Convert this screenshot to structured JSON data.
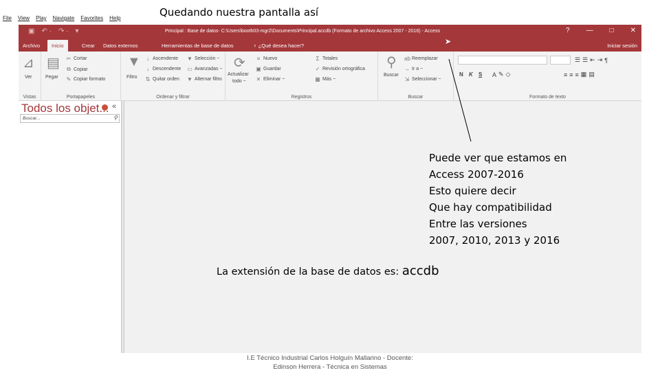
{
  "viewer_menu": [
    "File",
    "View",
    "Play",
    "Navigate",
    "Favorites",
    "Help"
  ],
  "slide_title": "Quedando nuestra pantalla así",
  "titlebar": {
    "title": "Principal : Base de datos- C:\\Users\\booth03-mgr2\\Documents\\Principal.accdb (Formato de archivo Access 2007 - 2016) - Access",
    "help": "?",
    "minimize": "—",
    "maximize": "□",
    "close": "✕",
    "accent": "#a4373a"
  },
  "tabs": [
    "Archivo",
    "Inicio",
    "Crear",
    "Datos externos",
    "Herramientas de base de datos",
    "¿Qué desea hacer?",
    "Iniciar sesión"
  ],
  "ribbon": {
    "vistas": {
      "ver": "Ver",
      "label": "Vistas"
    },
    "portapapeles": {
      "pegar": "Pegar",
      "cortar": "Cortar",
      "copiar": "Copiar",
      "copiar_formato": "Copiar formato",
      "label": "Portapapeles"
    },
    "ordenar": {
      "filtro": "Filtro",
      "ascendente": "Ascendente",
      "descendente": "Descendente",
      "quitar_orden": "Quitar orden",
      "seleccion": "Selección ~",
      "avanzadas": "Avanzadas ~",
      "alternar": "Alternar filtro",
      "label": "Ordenar y filtrar"
    },
    "registros": {
      "actualizar": "Actualizar",
      "todo": "todo ~",
      "nuevo": "Nuevo",
      "guardar": "Guardar",
      "eliminar": "Eliminar ~",
      "totales": "Totales",
      "revision": "Revisión ortográfica",
      "mas": "Más ~",
      "label": "Registros"
    },
    "buscar": {
      "buscar": "Buscar",
      "reemplazar": "Reemplazar",
      "ir_a": "Ir a ~",
      "seleccionar": "Seleccionar ~",
      "label": "Buscar"
    },
    "formato": {
      "label": "Formato de texto",
      "bold": "N",
      "italic": "K",
      "underline": "S",
      "font_a": "A"
    }
  },
  "nav_pane": {
    "title": "Todos los objet...",
    "collapse": "«",
    "search_placeholder": "Buscar..."
  },
  "annotation_lines": [
    "Puede ver que estamos en",
    "Access 2007-2016",
    "Esto quiere decir",
    "Que hay compatibilidad",
    "Entre las versiones",
    "2007, 2010, 2013 y 2016"
  ],
  "extension": {
    "prefix": "La extensión de la base de datos es: ",
    "value": "accdb"
  },
  "footer": [
    "I.E Técnico Industrial Carlos Holguín Mallarino - Docente:",
    "Edinson Herrera - Técnica en Sistemas"
  ]
}
